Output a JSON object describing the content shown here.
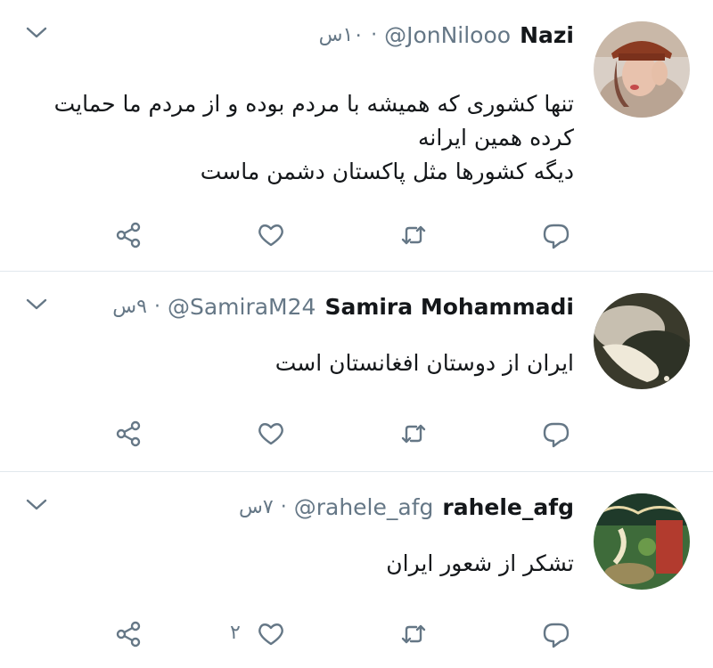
{
  "tweets": [
    {
      "name": "Nazi",
      "handle": "@JonNilooo",
      "separator": "·",
      "time": "۱۰س",
      "lines": [
        "تنها کشوری که همیشه با مردم بوده و از مردم ما حمایت",
        "کرده همین ایرانه",
        "دیگه کشورها مثل پاکستان دشمن ماست"
      ],
      "like_count": ""
    },
    {
      "name": "Samira Mohammadi",
      "handle": "@SamiraM24",
      "separator": "·",
      "time": "۹س",
      "lines": [
        "ایران از دوستان افغانستان است"
      ],
      "like_count": ""
    },
    {
      "name": "rahele_afg",
      "handle": "@rahele_afg",
      "separator": "·",
      "time": "۷س",
      "lines": [
        "تشکر از شعور ایران"
      ],
      "like_count": "۲"
    }
  ],
  "icons": {
    "caret": "chevron-down-icon",
    "share": "share-icon",
    "like": "heart-icon",
    "retweet": "retweet-icon",
    "reply": "reply-icon"
  },
  "colors": {
    "text": "#14171a",
    "muted": "#657786",
    "divider": "#e1e8ed"
  }
}
